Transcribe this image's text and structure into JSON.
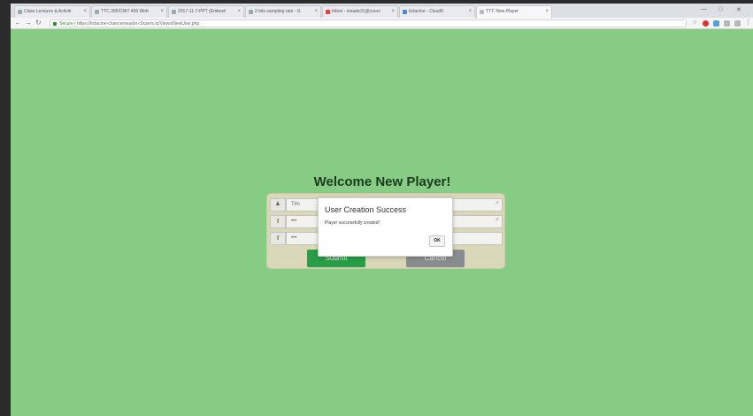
{
  "browser": {
    "tabs": [
      {
        "label": "Class Lectures & Activiti"
      },
      {
        "label": "TTC 395/CNIT 469 Web"
      },
      {
        "label": "2017-11-7-PPT (Embedi"
      },
      {
        "label": "2 bits sampling rate - G"
      },
      {
        "label": "Inbox - meade31@cours"
      },
      {
        "label": "tictactoe - Cloud9"
      },
      {
        "label": "TTT: New Player"
      }
    ],
    "window_controls": [
      "—",
      "□",
      "✕"
    ],
    "address": {
      "secure_label": "Secure",
      "url": "https://tictactoe-chancemeador.c9users.io/Views/NewUser.php"
    }
  },
  "page": {
    "heading": "Welcome New Player!",
    "form": {
      "username_value": "Tim",
      "password_value": "•••",
      "confirm_value": "•••",
      "submit_label": "Submit",
      "cancel_label": "Cancel"
    }
  },
  "modal": {
    "title": "User Creation Success",
    "message": "Player successfully created!",
    "ok_label": "OK"
  },
  "colors": {
    "page_bg": "#86cc85",
    "submit": "#2a9d46",
    "cancel": "#8a8d90"
  }
}
